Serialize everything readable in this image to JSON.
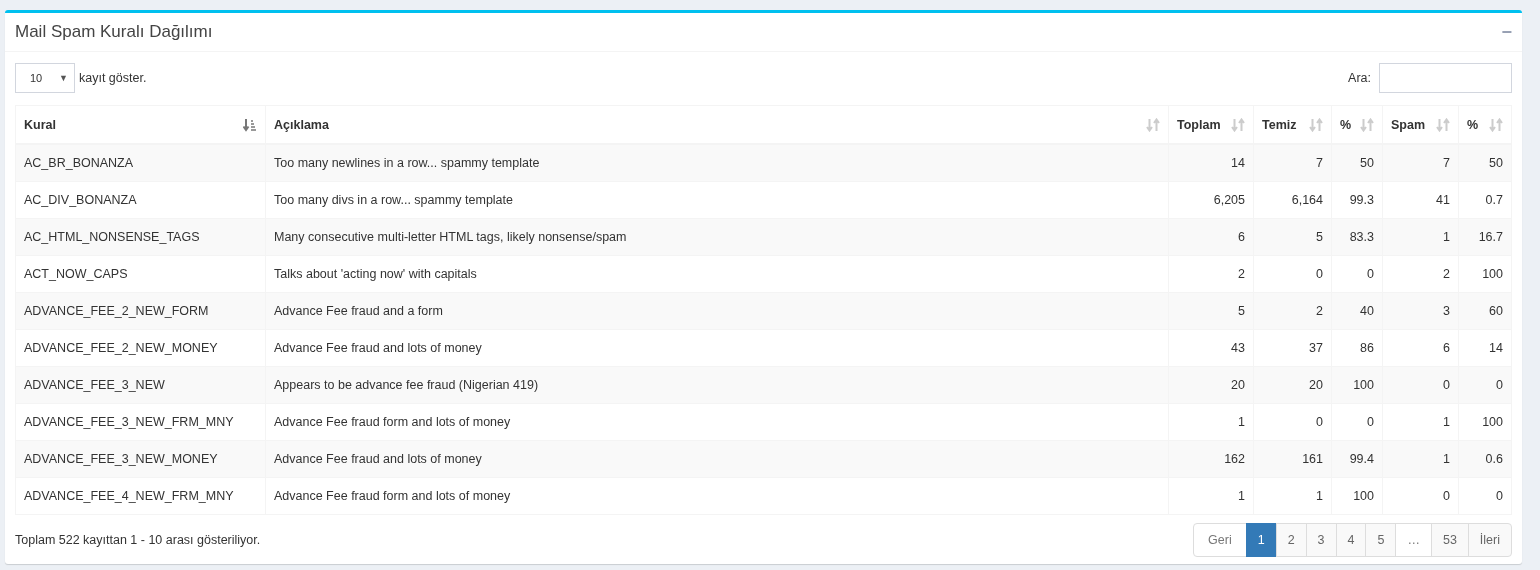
{
  "panel": {
    "title": "Mail Spam Kuralı Dağılımı",
    "collapse_icon": "−"
  },
  "length": {
    "value": "10",
    "caret": "▼",
    "label": "kayıt göster."
  },
  "search": {
    "label": "Ara:"
  },
  "table": {
    "columns": [
      {
        "label": "Kural",
        "sorted": true
      },
      {
        "label": "Açıklama",
        "sorted": false
      },
      {
        "label": "Toplam",
        "sorted": false
      },
      {
        "label": "Temiz",
        "sorted": false
      },
      {
        "label": "%",
        "sorted": false
      },
      {
        "label": "Spam",
        "sorted": false
      },
      {
        "label": "%",
        "sorted": false
      }
    ],
    "rows": [
      [
        "AC_BR_BONANZA",
        "Too many newlines in a row... spammy template",
        "14",
        "7",
        "50",
        "7",
        "50"
      ],
      [
        "AC_DIV_BONANZA",
        "Too many divs in a row... spammy template",
        "6,205",
        "6,164",
        "99.3",
        "41",
        "0.7"
      ],
      [
        "AC_HTML_NONSENSE_TAGS",
        "Many consecutive multi-letter HTML tags, likely nonsense/spam",
        "6",
        "5",
        "83.3",
        "1",
        "16.7"
      ],
      [
        "ACT_NOW_CAPS",
        "Talks about 'acting now' with capitals",
        "2",
        "0",
        "0",
        "2",
        "100"
      ],
      [
        "ADVANCE_FEE_2_NEW_FORM",
        "Advance Fee fraud and a form",
        "5",
        "2",
        "40",
        "3",
        "60"
      ],
      [
        "ADVANCE_FEE_2_NEW_MONEY",
        "Advance Fee fraud and lots of money",
        "43",
        "37",
        "86",
        "6",
        "14"
      ],
      [
        "ADVANCE_FEE_3_NEW",
        "Appears to be advance fee fraud (Nigerian 419)",
        "20",
        "20",
        "100",
        "0",
        "0"
      ],
      [
        "ADVANCE_FEE_3_NEW_FRM_MNY",
        "Advance Fee fraud form and lots of money",
        "1",
        "0",
        "0",
        "1",
        "100"
      ],
      [
        "ADVANCE_FEE_3_NEW_MONEY",
        "Advance Fee fraud and lots of money",
        "162",
        "161",
        "99.4",
        "1",
        "0.6"
      ],
      [
        "ADVANCE_FEE_4_NEW_FRM_MNY",
        "Advance Fee fraud form and lots of money",
        "1",
        "1",
        "100",
        "0",
        "0"
      ]
    ]
  },
  "info": "Toplam 522 kayıttan 1 - 10 arası gösteriliyor.",
  "pagination": [
    {
      "label": "Geri",
      "selected": false,
      "disabled": true
    },
    {
      "label": "1",
      "selected": true,
      "disabled": false
    },
    {
      "label": "2",
      "selected": false,
      "disabled": false
    },
    {
      "label": "3",
      "selected": false,
      "disabled": false
    },
    {
      "label": "4",
      "selected": false,
      "disabled": false
    },
    {
      "label": "5",
      "selected": false,
      "disabled": false
    },
    {
      "label": "…",
      "selected": false,
      "disabled": true
    },
    {
      "label": "53",
      "selected": false,
      "disabled": false
    },
    {
      "label": "İleri",
      "selected": false,
      "disabled": false
    }
  ]
}
